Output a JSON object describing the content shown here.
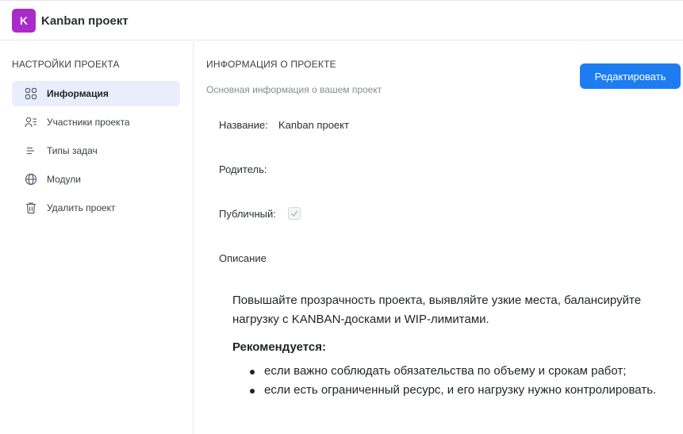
{
  "header": {
    "logo_letter": "K",
    "app_title": "Kanban проект"
  },
  "sidebar": {
    "title": "НАСТРОЙКИ ПРОЕКТА",
    "items": [
      {
        "label": "Информация",
        "icon": "grid-icon",
        "active": true
      },
      {
        "label": "Участники проекта",
        "icon": "users-list-icon",
        "active": false
      },
      {
        "label": "Типы задач",
        "icon": "lines-icon",
        "active": false
      },
      {
        "label": "Модули",
        "icon": "globe-icon",
        "active": false
      },
      {
        "label": "Удалить проект",
        "icon": "trash-icon",
        "active": false
      }
    ]
  },
  "main": {
    "title": "ИНФОРМАЦИЯ О ПРОЕКТЕ",
    "subtitle": "Основная информация о вашем проект",
    "edit_label": "Редактировать",
    "fields": {
      "name_label": "Название:",
      "name_value": "Kanban проект",
      "parent_label": "Родитель:",
      "public_label": "Публичный:",
      "public_checked": true,
      "description_label": "Описание"
    },
    "description": {
      "paragraph": "Повышайте прозрачность проекта, выявляйте узкие места, балансируйте нагрузку с KANBAN-досками и WIP-лимитами.",
      "recommended": "Рекомендуется:",
      "bullets": [
        "если важно соблюдать обязательства по объему и срокам работ;",
        "если есть ограниченный ресурс, и его нагрузку нужно контролировать."
      ]
    }
  },
  "colors": {
    "accent": "#1d7df0",
    "logo": "#a92bc8",
    "active_bg": "#e8eefb"
  }
}
